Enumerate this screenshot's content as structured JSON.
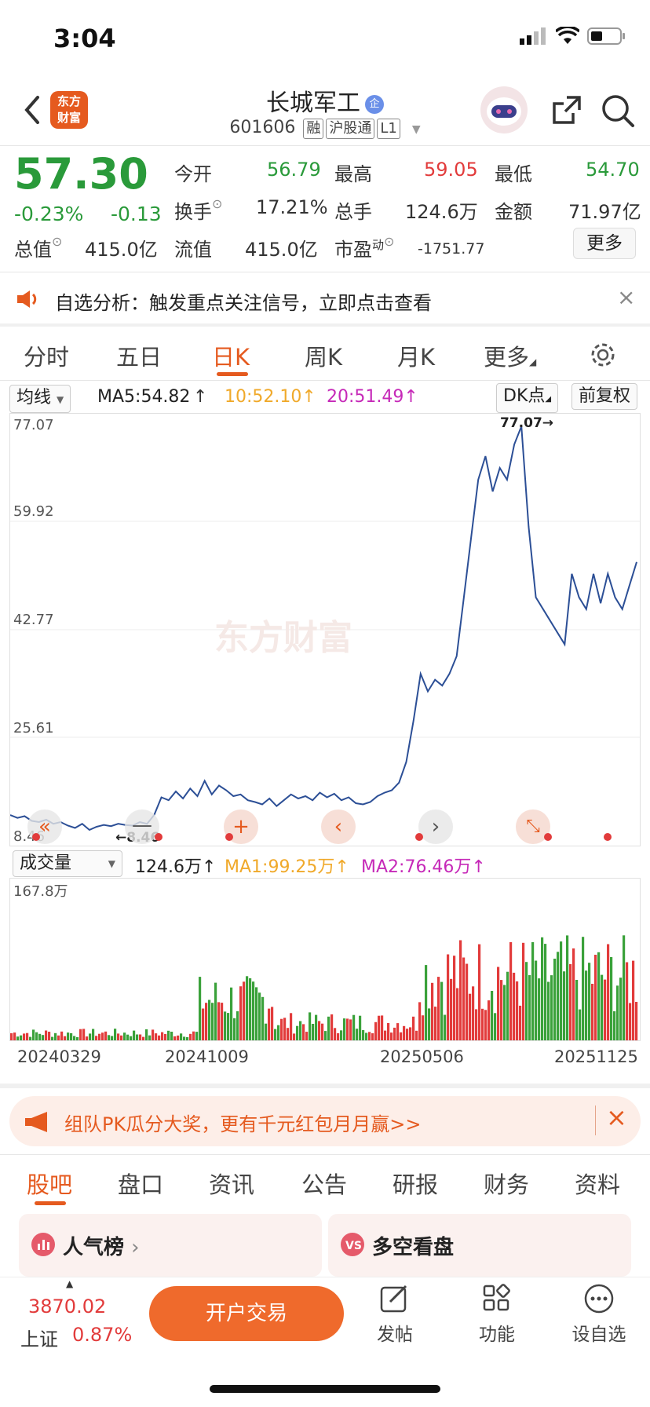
{
  "status": {
    "time": "3:04"
  },
  "header": {
    "title": "长城军工",
    "title_badge": "企",
    "code": "601606",
    "tags": [
      "融",
      "沪股通",
      "L1"
    ],
    "logo_text": [
      "东方",
      "财富"
    ]
  },
  "quote": {
    "price": "57.30",
    "pct": "-0.23%",
    "change": "-0.13",
    "open_label": "今开",
    "open": "56.79",
    "high_label": "最高",
    "high": "59.05",
    "low_label": "最低",
    "low": "54.70",
    "turnover_label": "换手",
    "turnover": "17.21%",
    "volume_label": "总手",
    "volume": "124.6万",
    "amount_label": "金额",
    "amount": "71.97亿",
    "mktcap_label": "总值",
    "mktcap": "415.0亿",
    "float_label": "流值",
    "float": "415.0亿",
    "pe_label": "市盈",
    "pe_sup": "动",
    "pe": "-1751.77",
    "more": "更多"
  },
  "notice": {
    "text": "自选分析：触发重点关注信号，立即点击查看"
  },
  "chart_tabs": {
    "items": [
      "分时",
      "五日",
      "日K",
      "周K",
      "月K",
      "更多"
    ],
    "active": "日K"
  },
  "ma_bar": {
    "selector": "均线",
    "ma5": "MA5:54.82",
    "ma10": "10:52.10",
    "ma20": "20:51.49",
    "dk": "DK点",
    "adjust": "前复权"
  },
  "price_chart": {
    "y_labels": [
      "77.07",
      "59.92",
      "42.77",
      "25.61",
      "8.46"
    ],
    "max_marker": "77.07→",
    "min_marker": "←8.46",
    "watermark": "东方财富"
  },
  "vol_bar": {
    "selector": "成交量",
    "vol": "124.6万",
    "ma1": "MA1:99.25万",
    "ma2": "MA2:76.46万",
    "max_label": "167.8万"
  },
  "dates": [
    "20240329",
    "20241009",
    "20250506",
    "20251125"
  ],
  "banner": {
    "text": "组队PK瓜分大奖，更有千元红包月月赢>>"
  },
  "bottom_tabs": {
    "items": [
      "股吧",
      "盘口",
      "资讯",
      "公告",
      "研报",
      "财务",
      "资料"
    ],
    "active": "股吧"
  },
  "cards": {
    "left": "人气榜",
    "right": "多空看盘"
  },
  "footer": {
    "index_value": "3870.02",
    "index_name": "上证",
    "index_pct": "0.87%",
    "trade": "开户交易",
    "post": "发帖",
    "func": "功能",
    "fav": "设自选"
  },
  "chart_data": {
    "type": "line",
    "ylim": [
      8.46,
      77.07
    ],
    "x_ticks": [
      "20240329",
      "20241009",
      "20250506",
      "20251125"
    ],
    "series": [
      {
        "values": [
          11,
          10.5,
          10.8,
          10,
          9.8,
          10.2,
          9.5,
          9.8,
          9.2,
          8.8,
          9.5,
          8.46,
          9,
          9.3,
          9.1,
          9.5,
          9.3,
          9.2,
          9.8,
          9.5,
          11,
          14,
          13.5,
          15,
          13.8,
          15.5,
          14.2,
          16.8,
          14.5,
          16,
          15.2,
          14.2,
          14.5,
          13.5,
          13.2,
          12.8,
          13.8,
          12.5,
          13.5,
          14.5,
          13.8,
          14.2,
          13.5,
          14.8,
          14,
          14.6,
          13.5,
          14,
          13,
          12.8,
          13.2,
          14.2,
          14.8,
          15.2,
          16.5,
          20,
          27,
          35,
          32,
          34,
          33,
          35,
          38,
          48,
          58,
          68,
          72,
          66,
          70,
          68,
          74,
          77.07,
          60,
          48,
          46,
          44,
          42,
          40,
          52,
          48,
          46,
          52,
          47,
          52,
          48,
          46,
          50,
          54
        ]
      }
    ],
    "volume_max": "167.8万"
  }
}
